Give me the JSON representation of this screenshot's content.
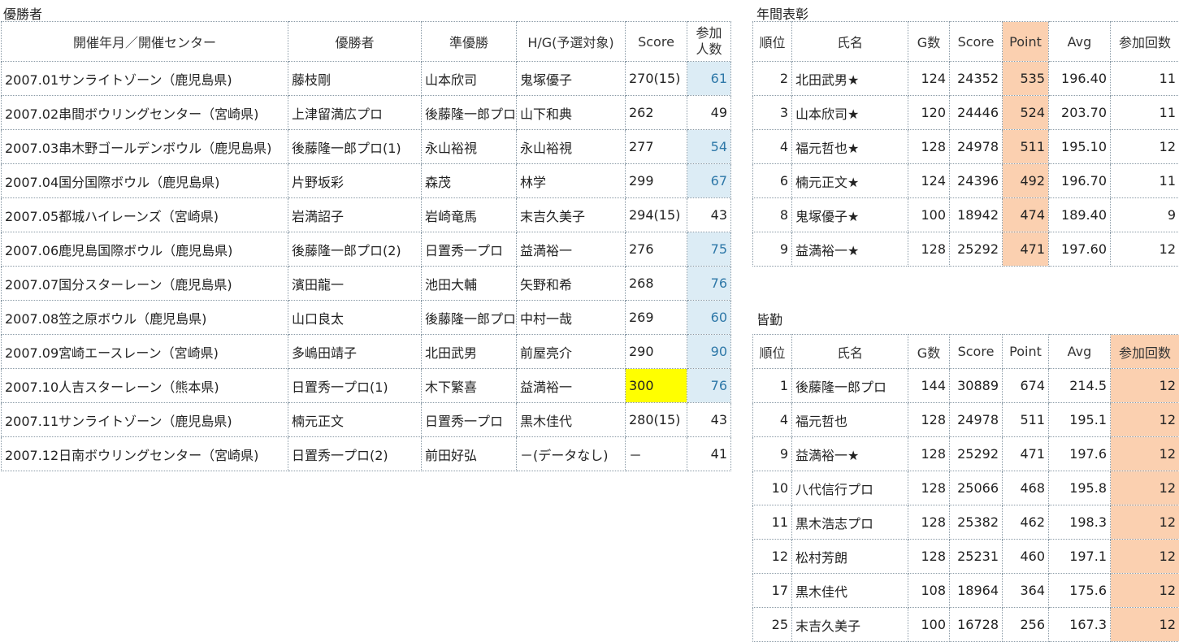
{
  "winners": {
    "title": "優勝者",
    "headers": [
      "開催年月／開催センター",
      "優勝者",
      "準優勝",
      "H/G(予選対象)",
      "Score",
      "参加\n人数"
    ],
    "header_participants_line1": "参加",
    "header_participants_line2": "人数",
    "rows": [
      {
        "event": "2007.01サンライトゾーン（鹿児島県)",
        "winner": "藤枝剛",
        "runner_up": "山本欣司",
        "hg": "鬼塚優子",
        "score": "270(15)",
        "participants": "61",
        "highlight": "blue"
      },
      {
        "event": "2007.02串間ボウリングセンター（宮崎県)",
        "winner": "上津留満広プロ",
        "runner_up": "後藤隆一郎プロ",
        "hg": "山下和典",
        "score": "262",
        "participants": "49",
        "highlight": ""
      },
      {
        "event": "2007.03串木野ゴールデンボウル（鹿児島県)",
        "winner": "後藤隆一郎プロ(1)",
        "runner_up": "永山裕視",
        "hg": "永山裕視",
        "score": "277",
        "participants": "54",
        "highlight": "blue"
      },
      {
        "event": "2007.04国分国際ボウル（鹿児島県)",
        "winner": "片野坂彩",
        "runner_up": "森茂",
        "hg": "林学",
        "score": "299",
        "participants": "67",
        "highlight": "blue"
      },
      {
        "event": "2007.05都城ハイレーンズ（宮崎県)",
        "winner": "岩満詔子",
        "runner_up": "岩崎竜馬",
        "hg": "末吉久美子",
        "score": "294(15)",
        "participants": "43",
        "highlight": ""
      },
      {
        "event": "2007.06鹿児島国際ボウル（鹿児島県)",
        "winner": "後藤隆一郎プロ(2)",
        "runner_up": "日置秀一プロ",
        "hg": "益満裕一",
        "score": "276",
        "participants": "75",
        "highlight": "blue"
      },
      {
        "event": "2007.07国分スターレーン（鹿児島県)",
        "winner": "濱田龍一",
        "runner_up": "池田大輔",
        "hg": "矢野和希",
        "score": "268",
        "participants": "76",
        "highlight": "blue"
      },
      {
        "event": "2007.08笠之原ボウル（鹿児島県)",
        "winner": "山口良太",
        "runner_up": "後藤隆一郎プロ",
        "hg": "中村一哉",
        "score": "269",
        "participants": "60",
        "highlight": "blue"
      },
      {
        "event": "2007.09宮崎エースレーン（宮崎県)",
        "winner": "多嶋田靖子",
        "runner_up": "北田武男",
        "hg": "前屋亮介",
        "score": "290",
        "participants": "90",
        "highlight": "blue"
      },
      {
        "event": "2007.10人吉スターレーン（熊本県)",
        "winner": "日置秀一プロ(1)",
        "runner_up": "木下繁喜",
        "hg": "益満裕一",
        "score": "300",
        "participants": "76",
        "highlight": "blue",
        "score_highlight": "yellow"
      },
      {
        "event": "2007.11サンライトゾーン（鹿児島県)",
        "winner": "楠元正文",
        "runner_up": "日置秀一プロ",
        "hg": "黒木佳代",
        "score": "280(15)",
        "participants": "43",
        "highlight": ""
      },
      {
        "event": "2007.12日南ボウリングセンター（宮崎県)",
        "winner": "日置秀一プロ(2)",
        "runner_up": "前田好弘",
        "hg": "－(データなし)",
        "score": "－",
        "participants": "41",
        "highlight": ""
      }
    ]
  },
  "annual": {
    "title": "年間表彰",
    "headers": [
      "順位",
      "氏名",
      "G数",
      "Score",
      "Point",
      "Avg",
      "参加回数"
    ],
    "rows": [
      {
        "rank": "2",
        "name": "北田武男★",
        "games": "124",
        "score": "24352",
        "point": "535",
        "avg": "196.40",
        "count": "11"
      },
      {
        "rank": "3",
        "name": "山本欣司★",
        "games": "120",
        "score": "24446",
        "point": "524",
        "avg": "203.70",
        "count": "11"
      },
      {
        "rank": "4",
        "name": "福元哲也★",
        "games": "128",
        "score": "24978",
        "point": "511",
        "avg": "195.10",
        "count": "12"
      },
      {
        "rank": "6",
        "name": "楠元正文★",
        "games": "124",
        "score": "24396",
        "point": "492",
        "avg": "196.70",
        "count": "11"
      },
      {
        "rank": "8",
        "name": "鬼塚優子★",
        "games": "100",
        "score": "18942",
        "point": "474",
        "avg": "189.40",
        "count": "9"
      },
      {
        "rank": "9",
        "name": "益満裕一★",
        "games": "128",
        "score": "25292",
        "point": "471",
        "avg": "197.60",
        "count": "12"
      }
    ]
  },
  "perfect": {
    "title": "皆勤",
    "headers": [
      "順位",
      "氏名",
      "G数",
      "Score",
      "Point",
      "Avg",
      "参加回数"
    ],
    "rows": [
      {
        "rank": "1",
        "name": "後藤隆一郎プロ",
        "games": "144",
        "score": "30889",
        "point": "674",
        "avg": "214.5",
        "count": "12"
      },
      {
        "rank": "4",
        "name": "福元哲也",
        "games": "128",
        "score": "24978",
        "point": "511",
        "avg": "195.1",
        "count": "12"
      },
      {
        "rank": "9",
        "name": "益満裕一★",
        "games": "128",
        "score": "25292",
        "point": "471",
        "avg": "197.6",
        "count": "12"
      },
      {
        "rank": "10",
        "name": "八代信行プロ",
        "games": "128",
        "score": "25066",
        "point": "468",
        "avg": "195.8",
        "count": "12"
      },
      {
        "rank": "11",
        "name": "黒木浩志プロ",
        "games": "128",
        "score": "25382",
        "point": "462",
        "avg": "198.3",
        "count": "12"
      },
      {
        "rank": "12",
        "name": "松村芳朗",
        "games": "128",
        "score": "25231",
        "point": "460",
        "avg": "197.1",
        "count": "12"
      },
      {
        "rank": "17",
        "name": "黒木佳代",
        "games": "108",
        "score": "18964",
        "point": "364",
        "avg": "175.6",
        "count": "12"
      },
      {
        "rank": "25",
        "name": "末吉久美子",
        "games": "100",
        "score": "16728",
        "point": "256",
        "avg": "167.3",
        "count": "12"
      }
    ]
  },
  "colors": {
    "blue_cell": "#dcecf5",
    "blue_text": "#2e78a8",
    "yellow_cell": "#ffff00",
    "peach_cell": "#fbd0b0"
  }
}
